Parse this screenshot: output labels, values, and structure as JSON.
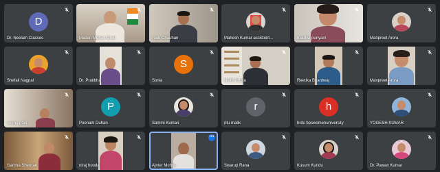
{
  "colors": {
    "background": "#202124",
    "tile": "#3c4043",
    "active_outline": "#8ab4f8",
    "more_button": "#1a73e8"
  },
  "icons": {
    "muted": "mic-off-icon",
    "more": "more-options-icon"
  },
  "participants": [
    {
      "name": "Dr. Neelam Classes",
      "avatar_letter": "D",
      "avatar_color": "#5f6bb8",
      "muted": true
    },
    {
      "name": "Madan Mohan Goel",
      "video": true,
      "muted": true
    },
    {
      "name": "Raju Chauhan",
      "video": true,
      "muted": true
    },
    {
      "name": "Mahesh Kumar assistent...",
      "photo": true,
      "muted": true
    },
    {
      "name": "madhvi punyani",
      "video": true,
      "muted": true
    },
    {
      "name": "Manpreet Arora",
      "photo": true,
      "muted": true
    },
    {
      "name": "Shefali Nagpal",
      "photo": true,
      "muted": true
    },
    {
      "name": "Dr. Pratibha",
      "video": true,
      "muted": true
    },
    {
      "name": "Sonia",
      "avatar_letter": "S",
      "avatar_color": "#e8710a",
      "muted": true
    },
    {
      "name": "Nidhi Gupta",
      "video": true,
      "muted": true
    },
    {
      "name": "Reetika Bhardwaj",
      "video": true,
      "muted": true
    },
    {
      "name": "Manpreet Arora",
      "video": true,
      "muted": true
    },
    {
      "name": "veenu goel",
      "video": true,
      "muted": true
    },
    {
      "name": "Poonam Duhan",
      "avatar_letter": "P",
      "avatar_color": "#129eaf",
      "muted": true
    },
    {
      "name": "Sammi Kumari",
      "photo": true,
      "muted": true
    },
    {
      "name": "ritu malik",
      "avatar_letter": "r",
      "avatar_color": "#5f6368",
      "muted": true
    },
    {
      "name": "hrdc bpswomenuniversity",
      "avatar_letter": "h",
      "avatar_color": "#d93025",
      "muted": true
    },
    {
      "name": "YOGESH KUMAR",
      "photo": true,
      "muted": true
    },
    {
      "name": "Garima Sheoran",
      "video": true,
      "muted": true
    },
    {
      "name": "niraj hooda",
      "video": true,
      "muted": true
    },
    {
      "name": "Ajmer Mohra",
      "video": true,
      "muted": false,
      "active": true
    },
    {
      "name": "Swarup Rana",
      "photo": true,
      "muted": true
    },
    {
      "name": "Kusum Kundu",
      "photo": true,
      "muted": true
    },
    {
      "name": "Dr. Pawan Kumar",
      "photo": true,
      "muted": true
    }
  ]
}
